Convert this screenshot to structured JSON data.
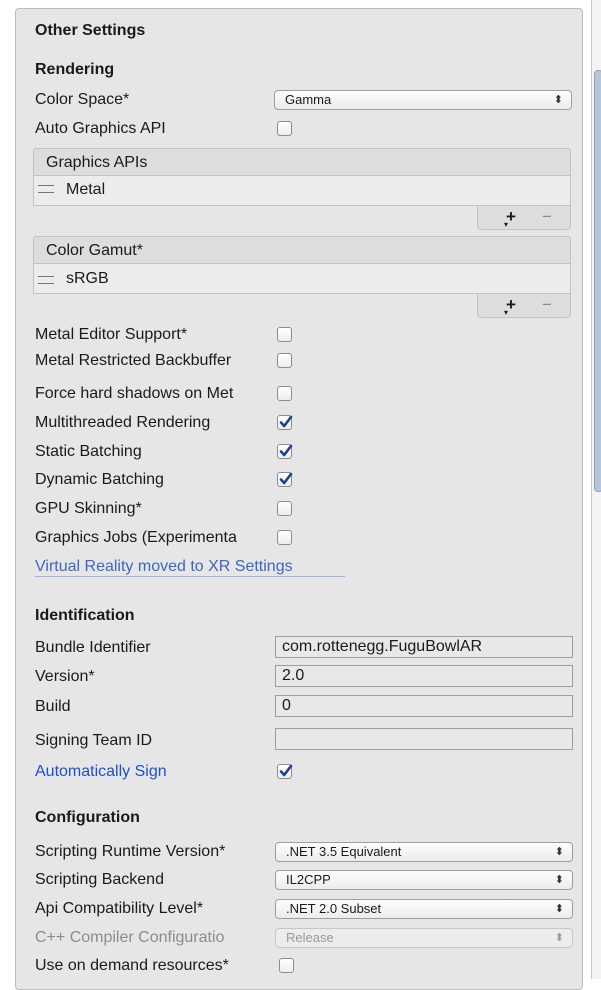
{
  "panel": {
    "title": "Other Settings"
  },
  "rendering": {
    "title": "Rendering",
    "color_space": {
      "label": "Color Space*",
      "value": "Gamma"
    },
    "auto_graphics_api": {
      "label": "Auto Graphics API",
      "checked": false
    },
    "graphics_apis": {
      "header": "Graphics APIs",
      "items": [
        "Metal"
      ],
      "add_label": "+",
      "remove_label": "−"
    },
    "color_gamut": {
      "header": "Color Gamut*",
      "items": [
        "sRGB"
      ],
      "add_label": "+",
      "remove_label": "−"
    },
    "toggles": [
      {
        "label": "Metal Editor Support*",
        "checked": false
      },
      {
        "label": "Metal Restricted Backbuffer",
        "checked": false
      },
      {
        "label": "Force hard shadows on Met",
        "checked": false
      },
      {
        "label": "Multithreaded Rendering",
        "checked": true
      },
      {
        "label": "Static Batching",
        "checked": true
      },
      {
        "label": "Dynamic Batching",
        "checked": true
      },
      {
        "label": "GPU Skinning*",
        "checked": false
      },
      {
        "label": "Graphics Jobs (Experimenta",
        "checked": false
      }
    ],
    "vr_link": "Virtual Reality moved to XR Settings"
  },
  "identification": {
    "title": "Identification",
    "bundle_identifier": {
      "label": "Bundle Identifier",
      "value": "com.rottenegg.FuguBowlAR"
    },
    "version": {
      "label": "Version*",
      "value": "2.0"
    },
    "build": {
      "label": "Build",
      "value": "0"
    },
    "signing_team_id": {
      "label": "Signing Team ID",
      "value": ""
    },
    "automatically_sign": {
      "label": "Automatically Sign",
      "checked": true
    }
  },
  "configuration": {
    "title": "Configuration",
    "scripting_runtime": {
      "label": "Scripting Runtime Version*",
      "value": ".NET 3.5 Equivalent"
    },
    "scripting_backend": {
      "label": "Scripting Backend",
      "value": "IL2CPP"
    },
    "api_compat": {
      "label": "Api Compatibility Level*",
      "value": ".NET 2.0 Subset"
    },
    "cpp_compiler": {
      "label": "C++ Compiler Configuratio",
      "value": "Release"
    },
    "on_demand": {
      "label": "Use on demand resources*",
      "checked": false
    }
  },
  "icons": {
    "dropdown_arrows": "⬍",
    "drag_handle": "—",
    "checkmark": "check-icon"
  },
  "colors": {
    "link": "#3d66c4",
    "check": "#1f3f8f",
    "panel_bg": "#e6e6e6"
  }
}
